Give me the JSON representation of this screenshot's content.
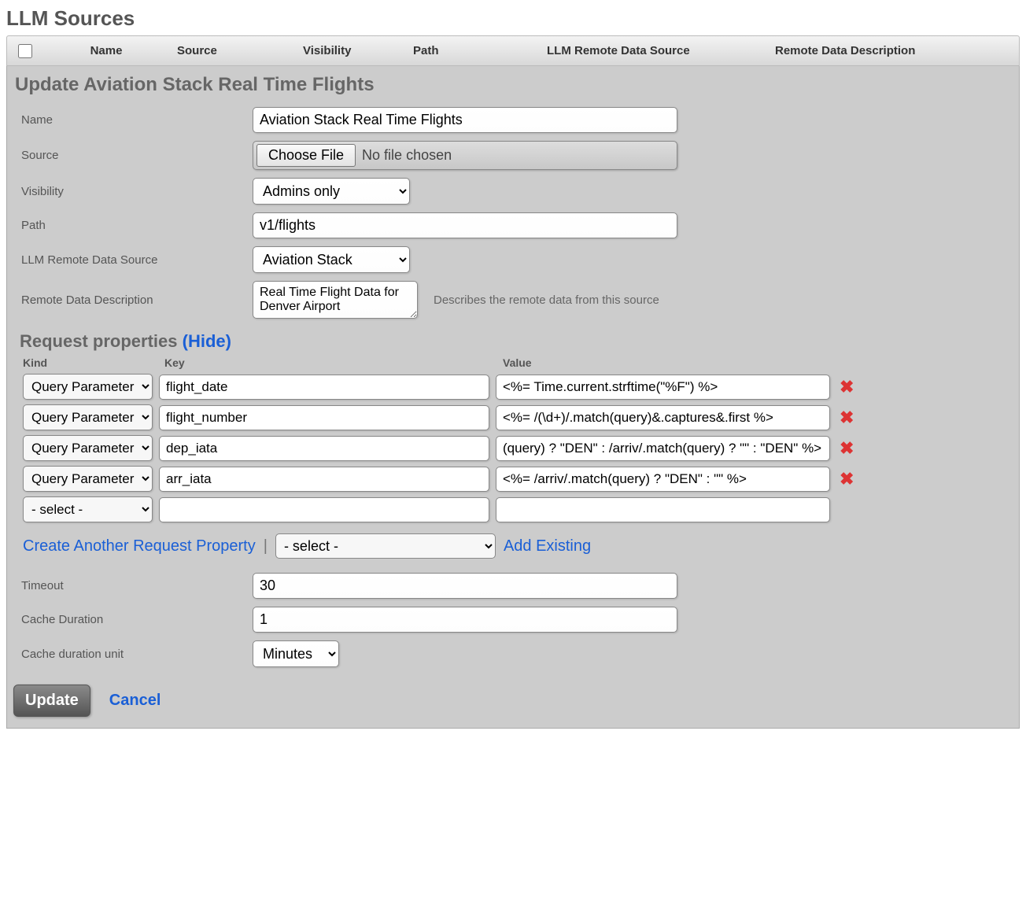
{
  "page_title": "LLM Sources",
  "table_headers": {
    "name": "Name",
    "source": "Source",
    "visibility": "Visibility",
    "path": "Path",
    "remote_source": "LLM Remote Data Source",
    "remote_desc": "Remote Data Description"
  },
  "panel_title": "Update Aviation Stack Real Time Flights",
  "fields": {
    "name": {
      "label": "Name",
      "value": "Aviation Stack Real Time Flights"
    },
    "source": {
      "label": "Source",
      "button": "Choose File",
      "status": "No file chosen"
    },
    "visibility": {
      "label": "Visibility",
      "value": "Admins only"
    },
    "path": {
      "label": "Path",
      "value": "v1/flights"
    },
    "remote_source": {
      "label": "LLM Remote Data Source",
      "value": "Aviation Stack"
    },
    "remote_desc": {
      "label": "Remote Data Description",
      "value": "Real Time Flight Data for Denver Airport",
      "helper": "Describes the remote data from this source"
    }
  },
  "request_properties": {
    "title": "Request properties",
    "toggle": "(Hide)",
    "headers": {
      "kind": "Kind",
      "key": "Key",
      "value": "Value"
    },
    "rows": [
      {
        "kind": "Query Parameter",
        "key": "flight_date",
        "value": "<%= Time.current.strftime(\"%F\") %>"
      },
      {
        "kind": "Query Parameter",
        "key": "flight_number",
        "value": "<%= /(\\d+)/.match(query)&.captures&.first %>"
      },
      {
        "kind": "Query Parameter",
        "key": "dep_iata",
        "value": "(query) ? \"DEN\" : /arriv/.match(query) ? \"\" : \"DEN\" %>"
      },
      {
        "kind": "Query Parameter",
        "key": "arr_iata",
        "value": "<%= /arriv/.match(query) ? \"DEN\" : \"\" %>"
      },
      {
        "kind": "- select -",
        "key": "",
        "value": ""
      }
    ],
    "actions": {
      "create_another": "Create Another Request Property",
      "select_placeholder": "- select -",
      "add_existing": "Add Existing"
    }
  },
  "timeout": {
    "label": "Timeout",
    "value": "30"
  },
  "cache_duration": {
    "label": "Cache Duration",
    "value": "1"
  },
  "cache_unit": {
    "label": "Cache duration unit",
    "value": "Minutes"
  },
  "buttons": {
    "update": "Update",
    "cancel": "Cancel"
  }
}
